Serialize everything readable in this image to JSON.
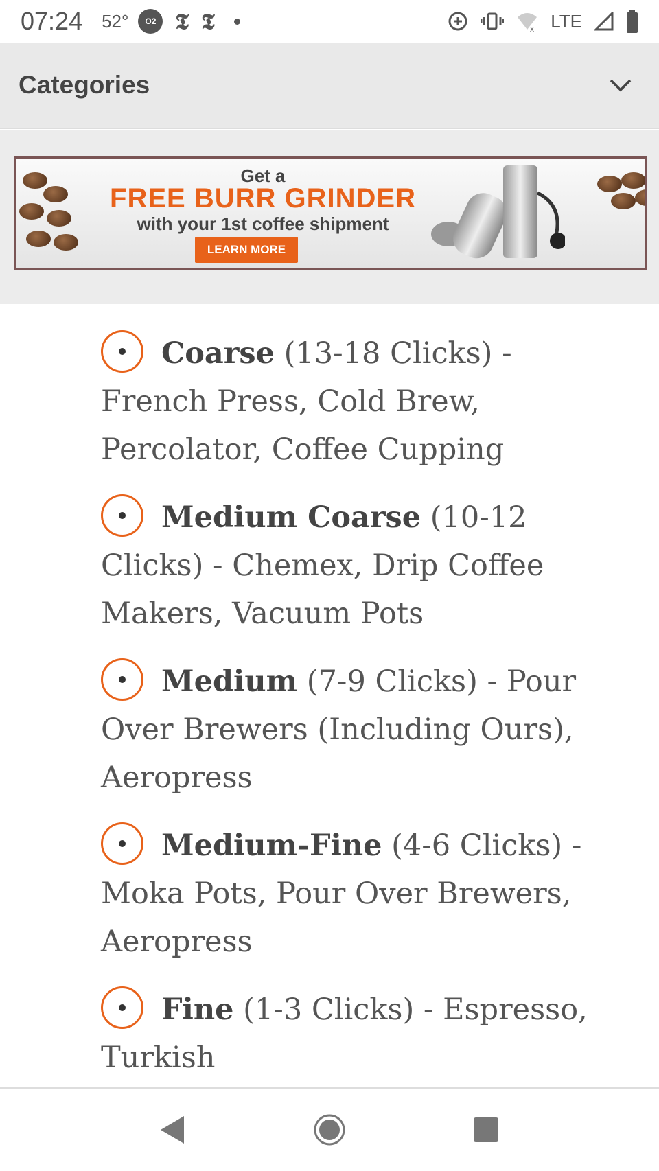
{
  "status": {
    "time": "07:24",
    "temp": "52°",
    "badge": "O2",
    "nyt1": "𝕿",
    "nyt2": "𝕿",
    "network": "LTE"
  },
  "header": {
    "title": "Categories"
  },
  "banner": {
    "line1": "Get a",
    "line2": "FREE BURR GRINDER",
    "line3": "with your 1st coffee shipment",
    "button": "LEARN MORE"
  },
  "grinds": [
    {
      "name": "Coarse",
      "detail": " (13-18 Clicks) - French Press, Cold Brew, Percolator, Coffee Cupping"
    },
    {
      "name": "Medium Coarse",
      "detail": " (10-12 Clicks) - Chemex, Drip Coffee Makers, Vacuum Pots"
    },
    {
      "name": "Medium",
      "detail": " (7-9 Clicks) - Pour Over Brewers (Including Ours), Aeropress"
    },
    {
      "name": "Medium-Fine",
      "detail": " (4-6 Clicks) - Moka Pots, Pour Over Brewers, Aeropress"
    },
    {
      "name": "Fine",
      "detail": " (1-3 Clicks) - Espresso, Turkish"
    }
  ],
  "colors": {
    "accent": "#e8621a",
    "text": "#555555"
  }
}
